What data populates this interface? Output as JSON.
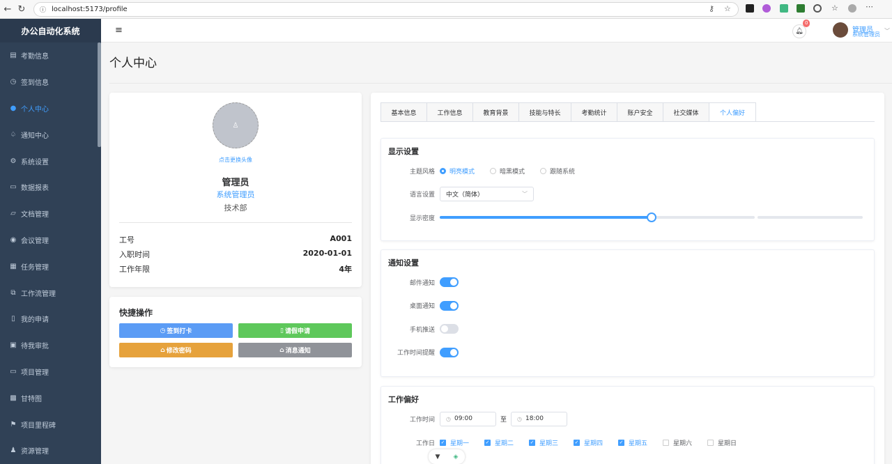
{
  "browser": {
    "url": "localhost:5173/profile"
  },
  "sidebar": {
    "app_title": "办公自动化系统",
    "items": [
      {
        "label": "考勤信息",
        "icon": "calendar-icon"
      },
      {
        "label": "签到信息",
        "icon": "clock-icon"
      },
      {
        "label": "个人中心",
        "icon": "user-icon"
      },
      {
        "label": "通知中心",
        "icon": "bell-icon"
      },
      {
        "label": "系统设置",
        "icon": "gear-icon"
      },
      {
        "label": "数据报表",
        "icon": "chart-icon"
      },
      {
        "label": "文档管理",
        "icon": "folder-icon"
      },
      {
        "label": "会议管理",
        "icon": "video-icon"
      },
      {
        "label": "任务管理",
        "icon": "clipboard-icon"
      },
      {
        "label": "工作流管理",
        "icon": "flow-icon"
      },
      {
        "label": "我的申请",
        "icon": "document-icon"
      },
      {
        "label": "待我审批",
        "icon": "approval-icon"
      },
      {
        "label": "项目管理",
        "icon": "briefcase-icon"
      },
      {
        "label": "甘特图",
        "icon": "gantt-icon"
      },
      {
        "label": "项目里程碑",
        "icon": "flag-icon"
      },
      {
        "label": "资源管理",
        "icon": "person-icon"
      }
    ],
    "active_index": 2,
    "colors": {
      "background": "#304156",
      "active": "#409eff"
    }
  },
  "header": {
    "menu_icon": "hamburger-icon",
    "notification_count": "0",
    "user_name": "管理员",
    "user_role": "系统管理员"
  },
  "page": {
    "title": "个人中心"
  },
  "profile": {
    "change_avatar": "点击更换头像",
    "name": "管理员",
    "role": "系统管理员",
    "department": "技术部",
    "info": [
      {
        "label": "工号",
        "value": "A001"
      },
      {
        "label": "入职时间",
        "value": "2020-01-01"
      },
      {
        "label": "工作年限",
        "value": "4年"
      }
    ]
  },
  "quick_actions": {
    "title": "快捷操作",
    "buttons": [
      {
        "label": "签到打卡",
        "color": "#5b9cf5"
      },
      {
        "label": "请假申请",
        "color": "#5ec85b"
      },
      {
        "label": "修改密码",
        "color": "#e6a23c"
      },
      {
        "label": "消息通知",
        "color": "#909399"
      }
    ]
  },
  "tabs": [
    "基本信息",
    "工作信息",
    "教育背景",
    "技能与特长",
    "考勤统计",
    "账户安全",
    "社交媒体",
    "个人偏好"
  ],
  "active_tab": 7,
  "display_settings": {
    "title": "显示设置",
    "theme_label": "主题风格",
    "theme_options": [
      "明亮模式",
      "暗黑模式",
      "跟随系统"
    ],
    "theme_selected": 0,
    "language_label": "语言设置",
    "language_value": "中文（简体）",
    "density_label": "显示密度",
    "density_level": 0.5
  },
  "notification_settings": {
    "title": "通知设置",
    "items": [
      {
        "label": "邮件通知",
        "on": true
      },
      {
        "label": "桌面通知",
        "on": true
      },
      {
        "label": "手机推送",
        "on": false
      },
      {
        "label": "工作时间提醒",
        "on": true
      }
    ]
  },
  "work_preferences": {
    "title": "工作偏好",
    "time_label": "工作时间",
    "start": "09:00",
    "separator": "至",
    "end": "18:00",
    "days_label": "工作日",
    "days": [
      {
        "label": "星期一",
        "on": true
      },
      {
        "label": "星期二",
        "on": true
      },
      {
        "label": "星期三",
        "on": true
      },
      {
        "label": "星期四",
        "on": true
      },
      {
        "label": "星期五",
        "on": true
      },
      {
        "label": "星期六",
        "on": false
      },
      {
        "label": "星期日",
        "on": false
      }
    ]
  }
}
